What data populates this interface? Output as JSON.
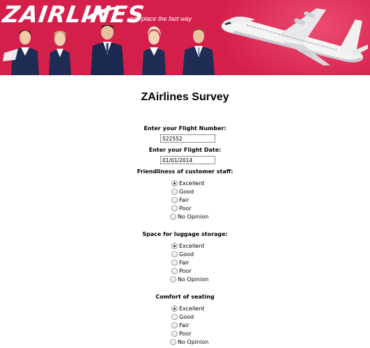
{
  "brand": {
    "logo": "ZAIRLINES",
    "tagline": "any place the fast way",
    "colors": {
      "banner": "#d51f4b",
      "uniform": "#1f2d55",
      "accent": "#ffffff"
    }
  },
  "survey": {
    "title": "ZAirlines Survey",
    "flight_number": {
      "label": "Enter your Flight Number:",
      "value": "522552"
    },
    "flight_date": {
      "label": "Enter your Flight Date:",
      "value": "01/01/2014"
    },
    "questions": [
      {
        "label": "Friendliness of customer staff:",
        "options": [
          "Excellent",
          "Good",
          "Fair",
          "Poor",
          "No Opinion"
        ],
        "selected": "Excellent"
      },
      {
        "label": "Space for luggage storage:",
        "options": [
          "Excellent",
          "Good",
          "Fair",
          "Poor",
          "No Opinion"
        ],
        "selected": "Excellent"
      },
      {
        "label": "Comfort of seating",
        "options": [
          "Excellent",
          "Good",
          "Fair",
          "Poor",
          "No Opinion"
        ],
        "selected": "Excellent"
      }
    ]
  }
}
